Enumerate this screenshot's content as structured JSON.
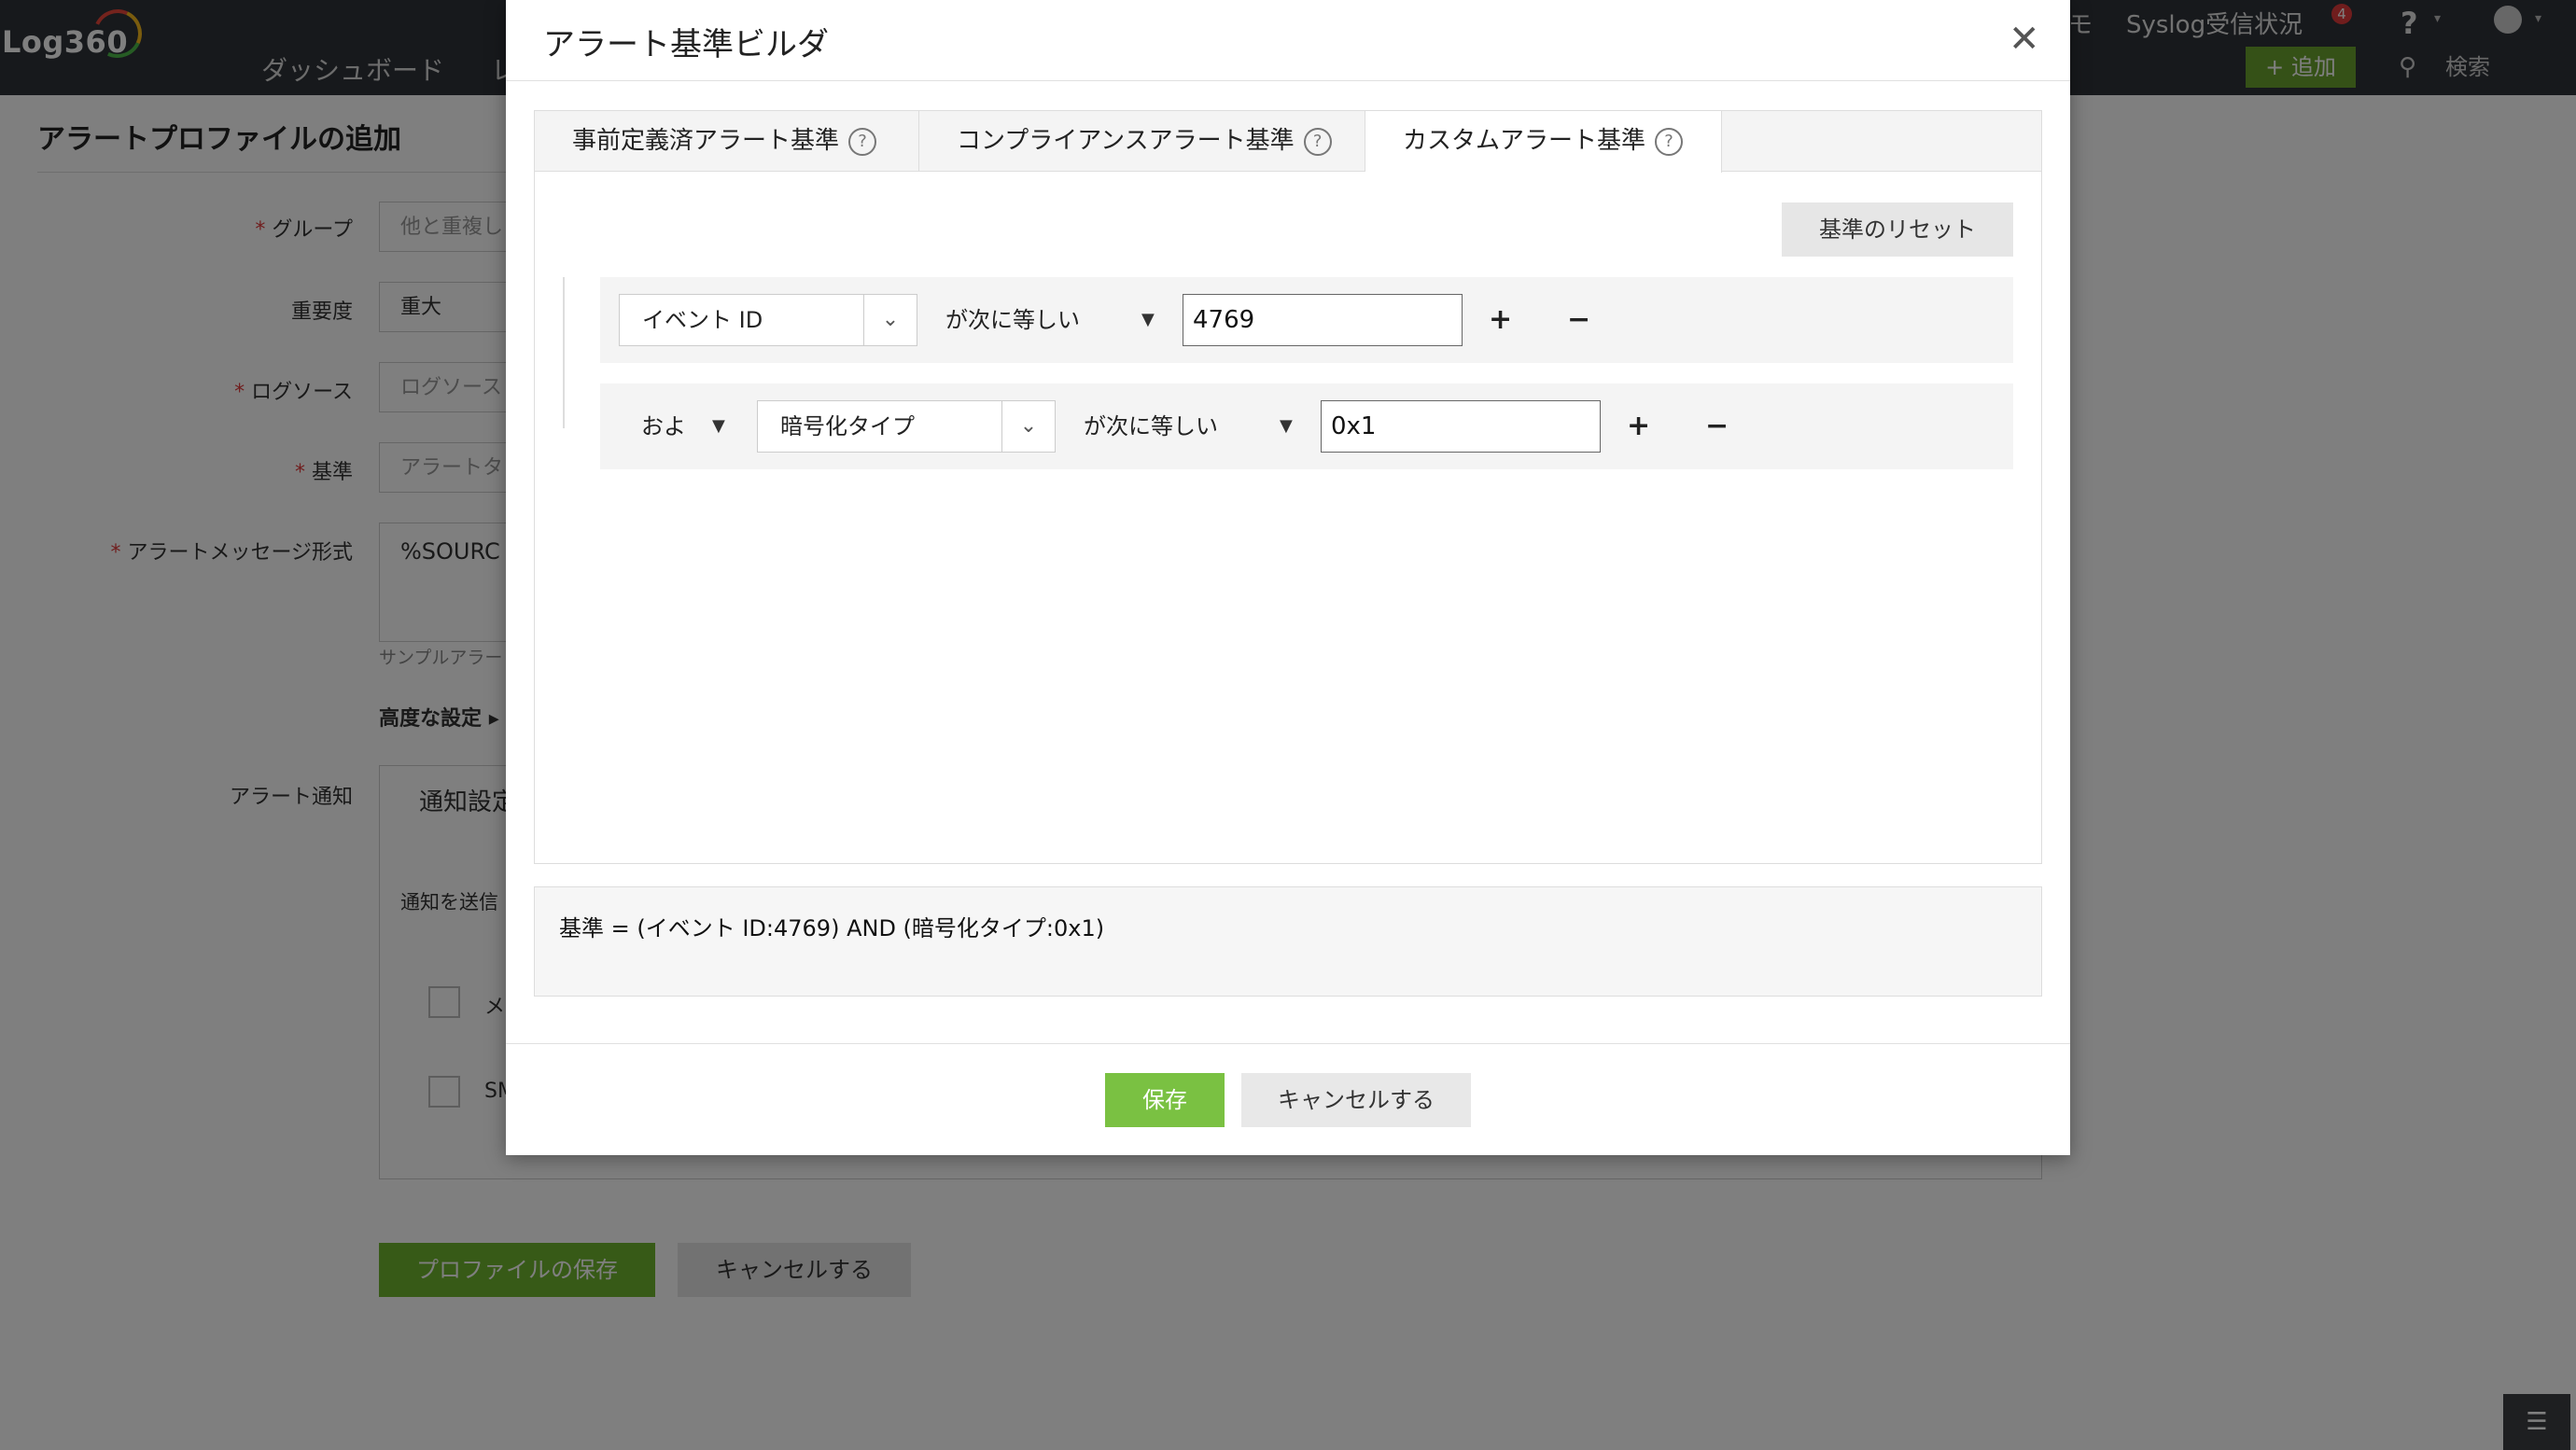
{
  "app": {
    "logo_text": "Log360",
    "nav": {
      "dashboard": "ダッシュボード",
      "report_partial": "レ"
    },
    "top": {
      "partial_text": "モ",
      "syslog_status": "Syslog受信状況",
      "notification_count": "4",
      "help_icon": "?"
    },
    "add_label": "+ 追加",
    "search_placeholder": "検索"
  },
  "page": {
    "title": "アラートプロファイルの追加",
    "fields": {
      "group": {
        "label": "グループ",
        "value": "他と重複し"
      },
      "severity": {
        "label": "重要度",
        "value": "重大"
      },
      "log_source": {
        "label": "ログソース",
        "value": "ログソース"
      },
      "criteria": {
        "label": "基準",
        "value": "アラートタ"
      },
      "message_format": {
        "label": "アラートメッセージ形式",
        "value": "%SOURC"
      }
    },
    "sample_text": "サンプルアラー",
    "advanced": "高度な設定",
    "alert_notification": {
      "label": "アラート通知",
      "tab": "通知設定",
      "send_label": "通知を送信",
      "options": [
        "メ",
        "SM"
      ]
    },
    "save_profile": "プロファイルの保存",
    "cancel": "キャンセルする"
  },
  "modal": {
    "title": "アラート基準ビルダ",
    "tabs": [
      {
        "label": "事前定義済アラート基準",
        "active": false
      },
      {
        "label": "コンプライアンスアラート基準",
        "active": false
      },
      {
        "label": "カスタムアラート基準",
        "active": true
      }
    ],
    "reset_label": "基準のリセット",
    "conditions": [
      {
        "field": "イベント ID",
        "operator": "が次に等しい",
        "value": "4769"
      },
      {
        "logic": "およ",
        "field": "暗号化タイプ",
        "operator": "が次に等しい",
        "value": "0x1"
      }
    ],
    "summary": "基準 = (イベント ID:4769) AND (暗号化タイプ:0x1)",
    "save_label": "保存",
    "cancel_label": "キャンセルする"
  },
  "colors": {
    "primary_green": "#7ac142",
    "topbar": "#2f3338",
    "required_asterisk": "#e03b3b"
  }
}
